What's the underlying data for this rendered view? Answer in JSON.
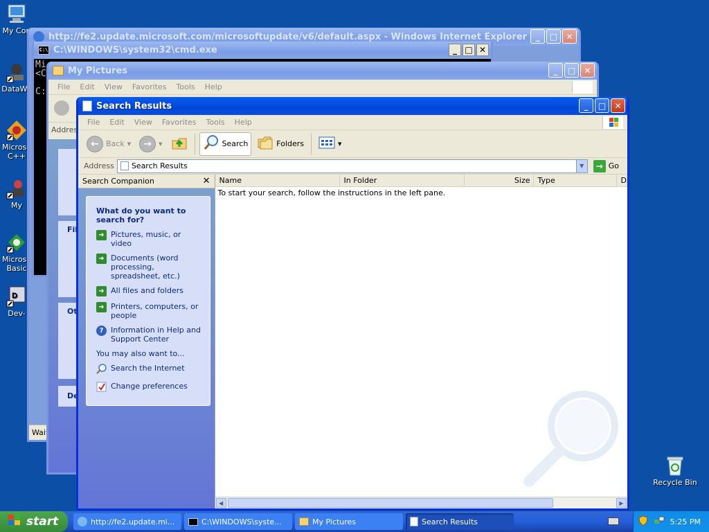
{
  "desktop": {
    "icons": [
      {
        "label": "My Con"
      },
      {
        "label": "DataWa"
      },
      {
        "label": "Microso C++"
      },
      {
        "label": "My"
      },
      {
        "label": "Microso Basic"
      },
      {
        "label": "Dev-"
      }
    ],
    "recycle_bin": "Recycle Bin"
  },
  "ie_window": {
    "title": "http://fe2.update.microsoft.com/microsoftupdate/v6/default.aspx - Windows Internet Explorer",
    "status": "Wait"
  },
  "cmd_window": {
    "title": "C:\\WINDOWS\\system32\\cmd.exe",
    "lines": [
      "Mi",
      "<C",
      "",
      "C:"
    ]
  },
  "pictures_window": {
    "title": "My Pictures",
    "menu": [
      "File",
      "Edit",
      "View",
      "Favorites",
      "Tools",
      "Help"
    ],
    "address_label": "Addres",
    "panels": [
      "File",
      "Oth",
      "De"
    ]
  },
  "search_window": {
    "title": "Search Results",
    "menu": [
      "File",
      "Edit",
      "View",
      "Favorites",
      "Tools",
      "Help"
    ],
    "toolbar": {
      "back": "Back",
      "search": "Search",
      "folders": "Folders"
    },
    "address": {
      "label": "Address",
      "value": "Search Results",
      "go": "Go"
    },
    "companion": {
      "header": "Search Companion",
      "question": "What do you want to search for?",
      "options": [
        "Pictures, music, or video",
        "Documents (word processing, spreadsheet, etc.)",
        "All files and folders",
        "Printers, computers, or people",
        "Information in Help and Support Center"
      ],
      "also_label": "You may also want to...",
      "also": [
        "Search the Internet",
        "Change preferences"
      ]
    },
    "columns": [
      "Name",
      "In Folder",
      "Size",
      "Type",
      "D"
    ],
    "empty_message": "To start your search, follow the instructions in the left pane."
  },
  "taskbar": {
    "start": "start",
    "tasks": [
      {
        "label": "http://fe2.update.mi..."
      },
      {
        "label": "C:\\WINDOWS\\syste..."
      },
      {
        "label": "My Pictures"
      },
      {
        "label": "Search Results"
      }
    ],
    "time": "5:25 PM"
  },
  "colors": {
    "desktop": "#0b4fa6",
    "titlebar": "#0246d8",
    "taskbar": "#245edb",
    "start": "#378a37"
  }
}
